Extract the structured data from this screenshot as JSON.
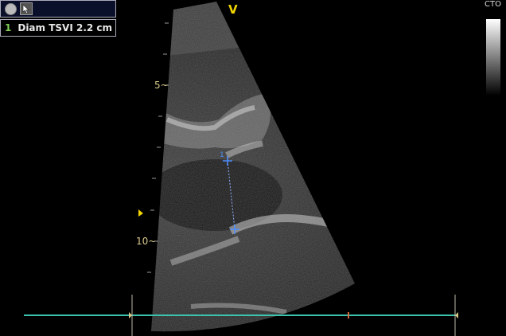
{
  "toolbar": {
    "tools": [
      {
        "icon": "circle-tool-icon"
      },
      {
        "icon": "pointer-tool-icon"
      }
    ]
  },
  "measurement": {
    "index": "1",
    "text": "Diam TSVI  2.2 cm"
  },
  "orientation_marker": "V",
  "gray_map_label": "CTO",
  "depth_scale": {
    "labels": [
      "5",
      "10"
    ]
  },
  "colors": {
    "caliper": "#4f8fff",
    "timeline": "#3cc4b0",
    "depth_label": "#d8c98a",
    "orientation": "#f2d400",
    "measurement_index": "#7fcf55"
  }
}
